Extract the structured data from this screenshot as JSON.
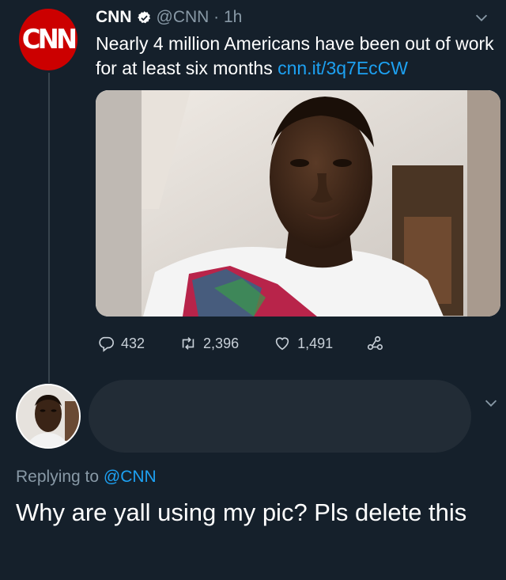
{
  "tweet": {
    "avatar_text": "CNN",
    "display_name": "CNN",
    "handle": "@CNN",
    "separator": " · ",
    "time": "1h",
    "text": "Nearly 4 million Americans have been out of work for at least six months ",
    "link": "cnn.it/3q7EcCW",
    "stats": {
      "replies": "432",
      "retweets": "2,396",
      "likes": "1,491"
    }
  },
  "reply": {
    "replying_prefix": "Replying to ",
    "replying_mention": "@CNN",
    "text": "Why are yall using my pic? Pls delete this"
  },
  "colors": {
    "background": "#15202b",
    "link": "#1da1f2",
    "muted": "#8899a6",
    "cnn_red": "#cc0000"
  },
  "icons": [
    "verified-badge-icon",
    "chevron-down-icon",
    "reply-icon",
    "retweet-icon",
    "like-icon",
    "share-icon"
  ]
}
